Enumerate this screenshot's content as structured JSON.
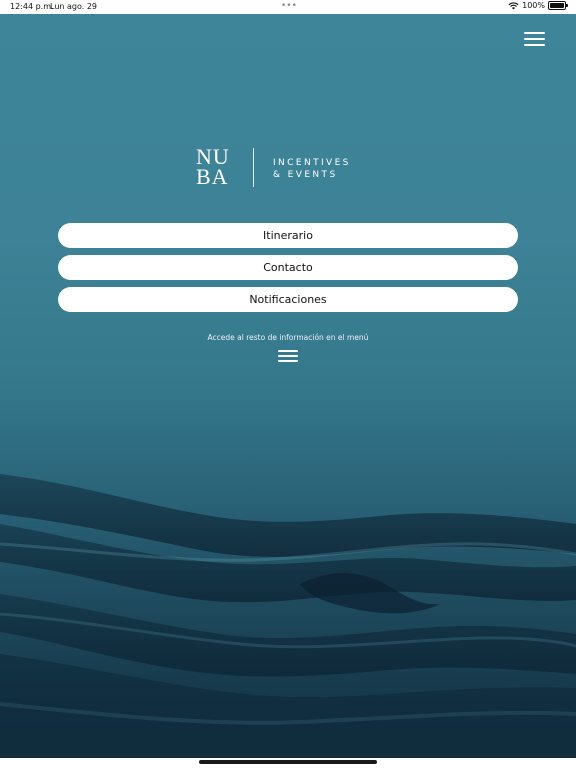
{
  "status_bar": {
    "time": "12:44 p.m.",
    "date": "Lun ago. 29",
    "dots": "•••",
    "battery": "100%"
  },
  "logo": {
    "line1": "NU",
    "line2": "BA",
    "tag_line1": "INCENTIVES",
    "tag_line2": "& EVENTS"
  },
  "buttons": [
    {
      "label": "Itinerario"
    },
    {
      "label": "Contacto"
    },
    {
      "label": "Notificaciones"
    }
  ],
  "hint": "Accede al resto de información en el menú",
  "colors": {
    "background_top": "#3e8599",
    "background_bottom": "#143446",
    "button_bg": "#ffffff",
    "text_on_dark": "#ffffff"
  },
  "icons": {
    "menu": "hamburger-icon",
    "wifi": "wifi-icon",
    "battery": "battery-icon"
  }
}
